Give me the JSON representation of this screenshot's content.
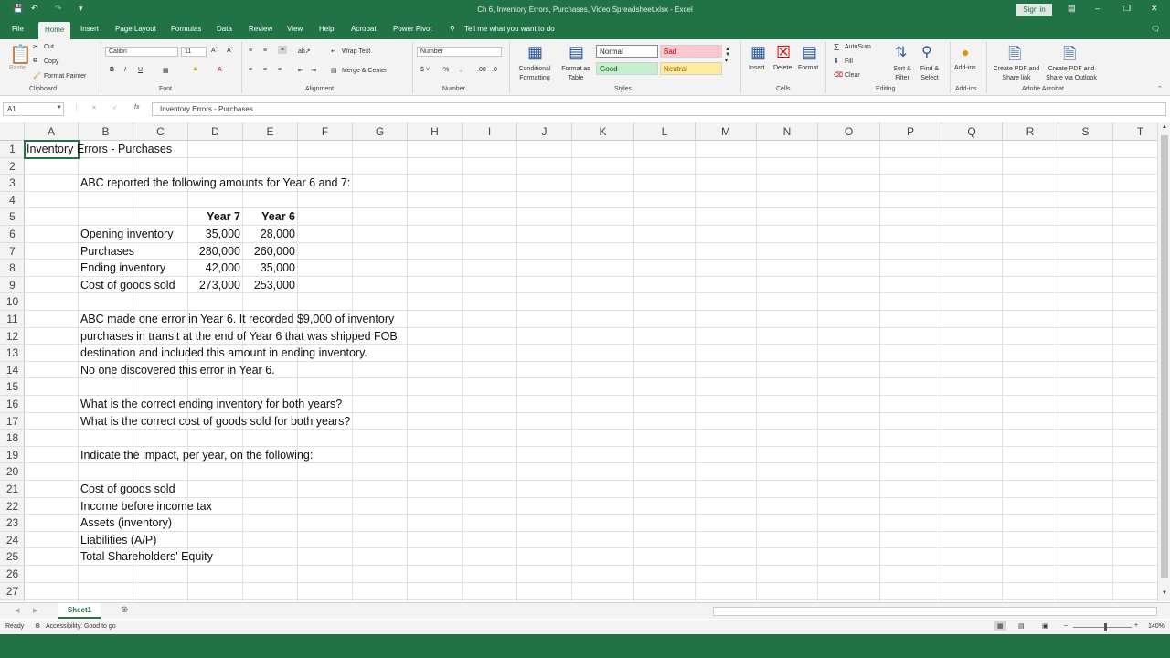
{
  "window": {
    "title": "Ch 6, Inventory Errors, Purchases, Video Spreadsheet.xlsx  -  Excel",
    "signin": "Sign in"
  },
  "tabs": [
    "File",
    "Home",
    "Insert",
    "Page Layout",
    "Formulas",
    "Data",
    "Review",
    "View",
    "Help",
    "Acrobat",
    "Power Pivot"
  ],
  "tell_me": "Tell me what you want to do",
  "ribbon": {
    "clipboard": {
      "paste": "Paste",
      "cut": "Cut",
      "copy": "Copy",
      "format_painter": "Format Painter",
      "group": "Clipboard"
    },
    "font": {
      "name": "Calibri",
      "size": "11",
      "group": "Font"
    },
    "alignment": {
      "wrap": "Wrap Text",
      "merge": "Merge & Center",
      "group": "Alignment"
    },
    "number": {
      "format": "Number",
      "group": "Number"
    },
    "styles": {
      "conditional": "Conditional Formatting",
      "format_table": "Format as Table",
      "normal": "Normal",
      "bad": "Bad",
      "good": "Good",
      "neutral": "Neutral",
      "group": "Styles"
    },
    "cells": {
      "insert": "Insert",
      "delete": "Delete",
      "format": "Format",
      "group": "Cells"
    },
    "editing": {
      "autosum": "AutoSum",
      "fill": "Fill",
      "clear": "Clear",
      "sort": "Sort & Filter",
      "find": "Find & Select",
      "group": "Editing"
    },
    "addins": {
      "label": "Add-ins",
      "group": "Add-ins"
    },
    "acrobat": {
      "pdf_link": "Create PDF and Share link",
      "pdf_outlook": "Create PDF and Share via Outlook",
      "group": "Adobe Acrobat"
    }
  },
  "formula_bar": {
    "name_box": "A1",
    "fx": "fx",
    "content": "Inventory Errors - Purchases"
  },
  "columns": [
    "A",
    "B",
    "C",
    "D",
    "E",
    "F",
    "G",
    "H",
    "I",
    "J",
    "K",
    "L",
    "M",
    "N",
    "O",
    "P",
    "Q",
    "R",
    "S",
    "T"
  ],
  "rows": [
    "1",
    "2",
    "3",
    "4",
    "5",
    "6",
    "7",
    "8",
    "9",
    "10",
    "11",
    "12",
    "13",
    "14",
    "15",
    "16",
    "17",
    "18",
    "19",
    "20",
    "21",
    "22",
    "23",
    "24",
    "25",
    "26",
    "27"
  ],
  "cells": {
    "a1": "Inventory Errors - Purchases",
    "b3": "ABC reported the following amounts for Year 6 and 7:",
    "d5": "Year 7",
    "e5": "Year 6",
    "b6": "Opening inventory",
    "d6": "35,000",
    "e6": "28,000",
    "b7": "Purchases",
    "d7": "280,000",
    "e7": "260,000",
    "b8": "Ending inventory",
    "d8": "42,000",
    "e8": "35,000",
    "b9": "Cost of goods sold",
    "d9": "273,000",
    "e9": "253,000",
    "b11": "ABC made one error in Year 6. It recorded $9,000 of inventory",
    "b12": "purchases in transit at the end of Year 6 that was shipped FOB",
    "b13": "destination and included this amount in ending inventory.",
    "b14": "No one discovered this error in Year 6.",
    "b16": "What is the correct ending inventory for both years?",
    "b17": "What is the correct cost of goods sold for both years?",
    "b19": "Indicate the impact, per year, on the following:",
    "b21": "Cost of goods sold",
    "b22": "Income before income tax",
    "b23": "Assets (inventory)",
    "b24": "Liabilities (A/P)",
    "b25": "Total Shareholders' Equity"
  },
  "sheet_tab": "Sheet1",
  "status": {
    "ready": "Ready",
    "accessibility": "Accessibility: Good to go",
    "zoom": "140%"
  }
}
